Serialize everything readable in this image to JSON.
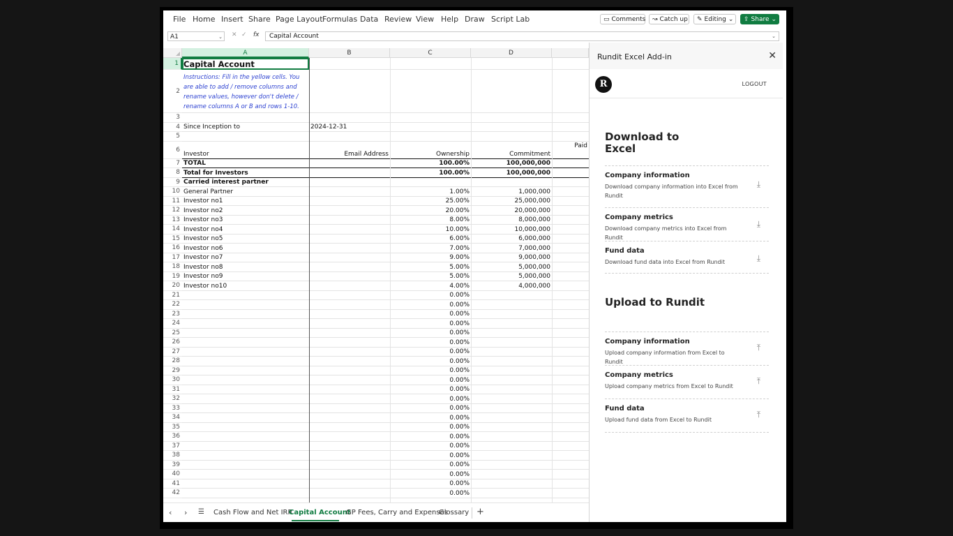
{
  "ribbon": {
    "menu": [
      "File",
      "Home",
      "Insert",
      "Share",
      "Page Layout",
      "Formulas",
      "Data",
      "Review",
      "View",
      "Help",
      "Draw",
      "Script Lab"
    ],
    "comments": "Comments",
    "catchup": "Catch up",
    "editing": "Editing",
    "share": "Share"
  },
  "formula": {
    "namebox": "A1",
    "fx": "fx",
    "content": "Capital Account"
  },
  "columns": [
    "A",
    "B",
    "C",
    "D"
  ],
  "rows": [
    {
      "n": "1",
      "a": "Capital Account",
      "b": "",
      "c": "",
      "d": "",
      "style": "title"
    },
    {
      "n": "2",
      "a": "Instructions: Fill in the yellow cells. You are able to add / remove columns and rename values, however don't delete / rename columns A or B and rows 1-10.",
      "b": "",
      "c": "",
      "d": "",
      "style": "instr"
    },
    {
      "n": "3",
      "a": "",
      "b": "",
      "c": "",
      "d": ""
    },
    {
      "n": "4",
      "a": "Since Inception to",
      "b": "2024-12-31",
      "c": "",
      "d": ""
    },
    {
      "n": "5",
      "a": "",
      "b": "",
      "c": "",
      "d": ""
    },
    {
      "n": "6",
      "a": "Investor",
      "b": "Email Address",
      "c": "Ownership",
      "d": "Commitment",
      "e": "Paid"
    },
    {
      "n": "7",
      "a": "TOTAL",
      "b": "",
      "c": "100.00%",
      "d": "100,000,000",
      "style": "bold"
    },
    {
      "n": "8",
      "a": "Total for Investors",
      "b": "",
      "c": "100.00%",
      "d": "100,000,000",
      "style": "bold"
    },
    {
      "n": "9",
      "a": "Carried interest partner",
      "b": "",
      "c": "",
      "d": "",
      "style": "bold"
    },
    {
      "n": "10",
      "a": "General Partner",
      "b": "",
      "c": "1.00%",
      "d": "1,000,000"
    },
    {
      "n": "11",
      "a": "Investor no1",
      "b": "",
      "c": "25.00%",
      "d": "25,000,000"
    },
    {
      "n": "12",
      "a": "Investor no2",
      "b": "",
      "c": "20.00%",
      "d": "20,000,000"
    },
    {
      "n": "13",
      "a": "Investor no3",
      "b": "",
      "c": "8.00%",
      "d": "8,000,000"
    },
    {
      "n": "14",
      "a": "Investor no4",
      "b": "",
      "c": "10.00%",
      "d": "10,000,000"
    },
    {
      "n": "15",
      "a": "Investor no5",
      "b": "",
      "c": "6.00%",
      "d": "6,000,000"
    },
    {
      "n": "16",
      "a": "Investor no6",
      "b": "",
      "c": "7.00%",
      "d": "7,000,000"
    },
    {
      "n": "17",
      "a": "Investor no7",
      "b": "",
      "c": "9.00%",
      "d": "9,000,000"
    },
    {
      "n": "18",
      "a": "Investor no8",
      "b": "",
      "c": "5.00%",
      "d": "5,000,000"
    },
    {
      "n": "19",
      "a": "Investor no9",
      "b": "",
      "c": "5.00%",
      "d": "5,000,000"
    },
    {
      "n": "20",
      "a": "Investor no10",
      "b": "",
      "c": "4.00%",
      "d": "4,000,000"
    },
    {
      "n": "21",
      "a": "",
      "b": "",
      "c": "0.00%",
      "d": ""
    },
    {
      "n": "22",
      "a": "",
      "b": "",
      "c": "0.00%",
      "d": ""
    },
    {
      "n": "23",
      "a": "",
      "b": "",
      "c": "0.00%",
      "d": ""
    },
    {
      "n": "24",
      "a": "",
      "b": "",
      "c": "0.00%",
      "d": ""
    },
    {
      "n": "25",
      "a": "",
      "b": "",
      "c": "0.00%",
      "d": ""
    },
    {
      "n": "26",
      "a": "",
      "b": "",
      "c": "0.00%",
      "d": ""
    },
    {
      "n": "27",
      "a": "",
      "b": "",
      "c": "0.00%",
      "d": ""
    },
    {
      "n": "28",
      "a": "",
      "b": "",
      "c": "0.00%",
      "d": ""
    },
    {
      "n": "29",
      "a": "",
      "b": "",
      "c": "0.00%",
      "d": ""
    },
    {
      "n": "30",
      "a": "",
      "b": "",
      "c": "0.00%",
      "d": ""
    },
    {
      "n": "31",
      "a": "",
      "b": "",
      "c": "0.00%",
      "d": ""
    },
    {
      "n": "32",
      "a": "",
      "b": "",
      "c": "0.00%",
      "d": ""
    },
    {
      "n": "33",
      "a": "",
      "b": "",
      "c": "0.00%",
      "d": ""
    },
    {
      "n": "34",
      "a": "",
      "b": "",
      "c": "0.00%",
      "d": ""
    },
    {
      "n": "35",
      "a": "",
      "b": "",
      "c": "0.00%",
      "d": ""
    },
    {
      "n": "36",
      "a": "",
      "b": "",
      "c": "0.00%",
      "d": ""
    },
    {
      "n": "37",
      "a": "",
      "b": "",
      "c": "0.00%",
      "d": ""
    },
    {
      "n": "38",
      "a": "",
      "b": "",
      "c": "0.00%",
      "d": ""
    },
    {
      "n": "39",
      "a": "",
      "b": "",
      "c": "0.00%",
      "d": ""
    },
    {
      "n": "40",
      "a": "",
      "b": "",
      "c": "0.00%",
      "d": ""
    },
    {
      "n": "41",
      "a": "",
      "b": "",
      "c": "0.00%",
      "d": ""
    },
    {
      "n": "42",
      "a": "",
      "b": "",
      "c": "0.00%",
      "d": ""
    }
  ],
  "pane": {
    "title": "Rundit Excel Add-in",
    "logo": "R",
    "logout": "LOGOUT",
    "download_title": "Download to Excel",
    "download_items": [
      {
        "title": "Company information",
        "desc": "Download company information into Excel from Rundit"
      },
      {
        "title": "Company metrics",
        "desc": "Download company metrics into Excel from Rundit"
      },
      {
        "title": "Fund data",
        "desc": "Download fund data into Excel from Rundit"
      }
    ],
    "upload_title": "Upload to Rundit",
    "upload_items": [
      {
        "title": "Company information",
        "desc": "Upload company information from Excel to Rundit"
      },
      {
        "title": "Company metrics",
        "desc": "Upload company metrics from Excel to Rundit"
      },
      {
        "title": "Fund data",
        "desc": "Upload fund data from Excel to Rundit"
      }
    ]
  },
  "sheets": {
    "tabs": [
      "Cash Flow and Net IRR",
      "Capital Account",
      "GP Fees, Carry and Expenses",
      "Glossary"
    ],
    "active": "Capital Account"
  }
}
